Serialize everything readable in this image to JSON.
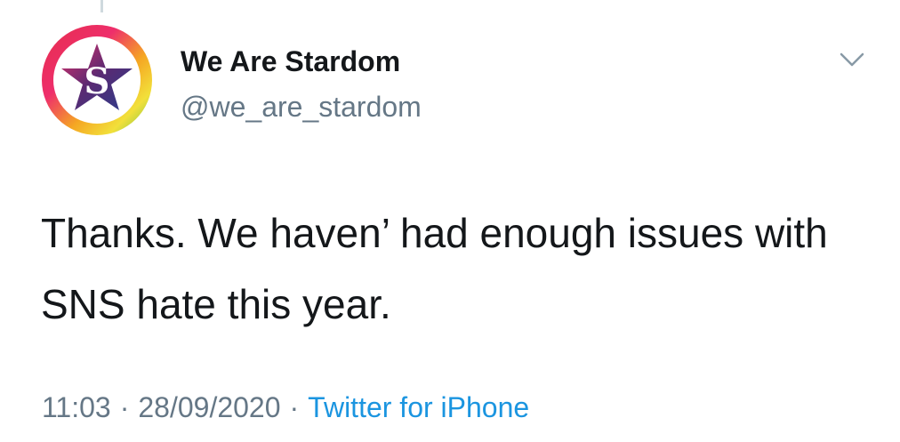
{
  "author": {
    "display_name": "We Are Stardom",
    "handle": "@we_are_stardom",
    "avatar_icon": "stardom-star-logo",
    "avatar_letter": "S"
  },
  "tweet": {
    "text": "Thanks. We haven’ had enough issues with SNS hate this year."
  },
  "meta": {
    "time": "11:03",
    "separator": "·",
    "date": "28/09/2020",
    "source": "Twitter for iPhone"
  },
  "icons": {
    "more_options": "chevron-down-icon"
  },
  "colors": {
    "text_primary": "#14171a",
    "text_secondary": "#657786",
    "link": "#1b95e0",
    "chevron": "#8899a6"
  }
}
